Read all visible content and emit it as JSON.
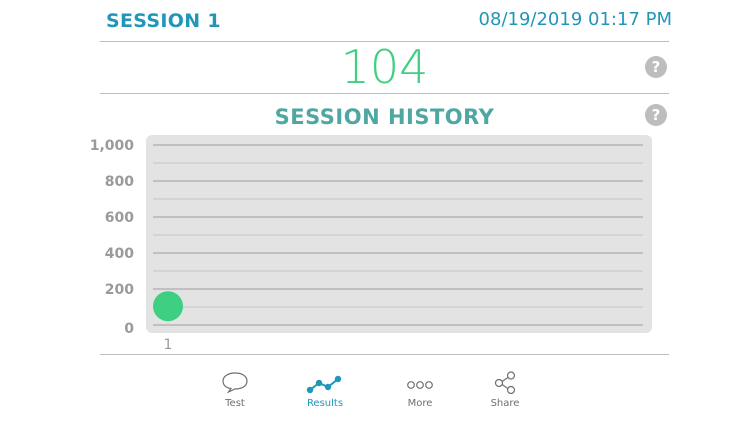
{
  "header": {
    "session_title": "SESSION 1",
    "datetime": "08/19/2019 01:17 PM"
  },
  "score": {
    "value": "104",
    "help": "?"
  },
  "history": {
    "title": "SESSION HISTORY",
    "help": "?"
  },
  "chart_data": {
    "type": "scatter",
    "title": "SESSION HISTORY",
    "x": [
      1
    ],
    "y": [
      104
    ],
    "xticks": [
      "1"
    ],
    "yticks": [
      "0",
      "200",
      "400",
      "600",
      "800",
      "1,000"
    ],
    "ylim": [
      0,
      1000
    ],
    "grid": true
  },
  "tabs": [
    {
      "label": "Test",
      "icon": "speech-bubble-icon",
      "active": false
    },
    {
      "label": "Results",
      "icon": "line-graph-icon",
      "active": true
    },
    {
      "label": "More",
      "icon": "ellipsis-icon",
      "active": false
    },
    {
      "label": "Share",
      "icon": "share-icon",
      "active": false
    }
  ],
  "colors": {
    "accent": "#2196b8",
    "score": "#3ecf83",
    "history_title": "#4ea7a0",
    "plot_bg": "#e3e3e3",
    "point": "#3ecf83",
    "tab_inactive": "#6f6f6f"
  }
}
